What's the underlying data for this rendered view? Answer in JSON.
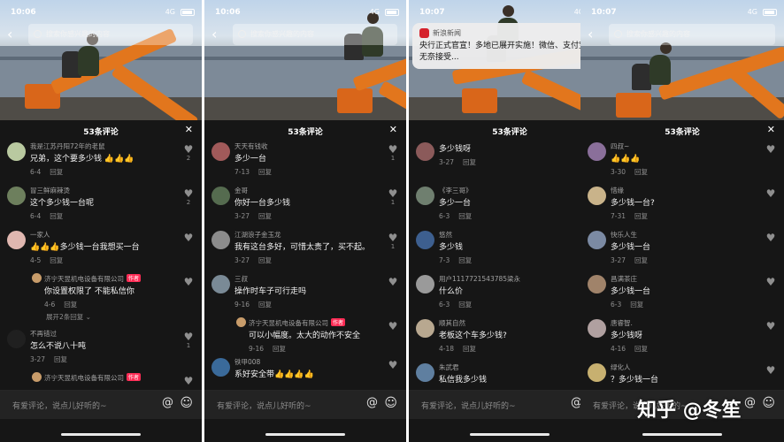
{
  "colors": {
    "background": "#161616",
    "username": "#a2a2a2",
    "text": "#f2f2f2",
    "meta": "#8f8f8f",
    "author_tag": "#fe2c55",
    "excavator": "#e2761d"
  },
  "panels": [
    {
      "time": "10:06",
      "signal": "4G",
      "search_placeholder": "搜索你感兴趣的内容",
      "sheet_title": "53条评论",
      "comments": [
        {
          "user": "我是江苏丹阳72年的老鼠",
          "text": "兄弟，这个要多少钱 👍👍👍",
          "date": "6-4",
          "reply": "回复",
          "likes": "2",
          "avatar_color": "#b9c9a0"
        },
        {
          "user": "冒三鲜麻辣烫",
          "text": "这个多少钱一台呢",
          "date": "6-4",
          "reply": "回复",
          "likes": "2",
          "avatar_color": "#6d7f5d"
        },
        {
          "user": "一家人",
          "text": "👍👍👍多少钱一台我想买一台",
          "date": "4-5",
          "reply": "回复",
          "likes": "",
          "avatar_color": "#e0b7b0"
        },
        {
          "is_reply": true,
          "user": "济宁天昱机电设备有限公司",
          "author_tag": "作者",
          "text": "你设置权限了 不能私信你",
          "date": "4-6",
          "reply": "回复",
          "likes": "",
          "avatar_color": "#c89c6a"
        },
        {
          "expand": "展开2条回复"
        },
        {
          "user": "不再错过",
          "text": "怎么不说八十吨",
          "date": "3-27",
          "reply": "回复",
          "likes": "1",
          "avatar_color": "#202020"
        },
        {
          "is_reply": true,
          "user": "济宁天昱机电设备有限公司",
          "author_tag": "作者",
          "text": "",
          "date": "",
          "reply": "",
          "likes": "",
          "avatar_color": "#c89c6a"
        }
      ],
      "input_placeholder": "有爱评论，说点儿好听的~"
    },
    {
      "time": "10:06",
      "signal": "4G",
      "search_placeholder": "搜索你感兴趣的内容",
      "sheet_title": "53条评论",
      "comments": [
        {
          "user": "天天有钱收",
          "text": "多少一台",
          "date": "7-13",
          "reply": "回复",
          "likes": "1",
          "avatar_color": "#a15a5a"
        },
        {
          "user": "金哥",
          "text": "你好一台多少钱",
          "date": "3-27",
          "reply": "回复",
          "likes": "1",
          "avatar_color": "#556b4f"
        },
        {
          "user": "江湖浪子金玉龙",
          "text": "我有这台多好，可惜太贵了，买不起。",
          "date": "3-27",
          "reply": "回复",
          "likes": "1",
          "avatar_color": "#8c8c8c"
        },
        {
          "user": "三叔",
          "text": "操作时车子可行走吗",
          "date": "9-16",
          "reply": "回复",
          "likes": "",
          "avatar_color": "#7a8a96"
        },
        {
          "is_reply": true,
          "user": "济宁天昱机电设备有限公司",
          "author_tag": "作者",
          "text": "可以小幅度。太大的动作不安全",
          "date": "9-16",
          "reply": "回复",
          "likes": "",
          "avatar_color": "#c89c6a"
        },
        {
          "user": "铁甲008",
          "text": "系好安全带👍👍👍👍",
          "date": "",
          "reply": "",
          "likes": "",
          "avatar_color": "#3a6a9a"
        }
      ],
      "input_placeholder": "有爱评论，说点儿好听的~"
    },
    {
      "time": "10:07",
      "signal": "4G",
      "notification": {
        "source": "新浪新闻",
        "body": "央行正式官宣！多地已展开实施！微信、支付宝只能无奈接受..."
      },
      "sheet_title": "53条评论",
      "comments": [
        {
          "user": "",
          "text": "多少钱呀",
          "date": "3-27",
          "reply": "回复",
          "likes": "",
          "avatar_color": "#8b5a5a"
        },
        {
          "user": "《李三哥》",
          "text": "多少一台",
          "date": "6-3",
          "reply": "回复",
          "likes": "",
          "avatar_color": "#6f7f6f"
        },
        {
          "user": "悠然",
          "text": "多少钱",
          "date": "7-3",
          "reply": "回复",
          "likes": "",
          "avatar_color": "#3d5f8f"
        },
        {
          "user": "用户1117721543785梁永",
          "text": "什么价",
          "date": "6-3",
          "reply": "回复",
          "likes": "",
          "avatar_color": "#9a9a9a"
        },
        {
          "user": "顺其自然",
          "text": "老板这个车多少钱?",
          "date": "4-18",
          "reply": "回复",
          "likes": "",
          "avatar_color": "#b8a890"
        },
        {
          "user": "朱武君",
          "text": "私信我多少钱",
          "date": "",
          "reply": "",
          "likes": "",
          "avatar_color": "#5f7fa0"
        }
      ],
      "input_placeholder": "有爱评论，说点儿好听的~"
    },
    {
      "time": "10:07",
      "signal": "4G",
      "search_placeholder": "搜索你感兴趣的内容",
      "sheet_title": "53条评论",
      "comments": [
        {
          "user": "四叔~",
          "text": "👍👍👍",
          "date": "3-30",
          "reply": "回复",
          "likes": "",
          "avatar_color": "#8a6f9a"
        },
        {
          "user": "惜缘",
          "text": "多少钱一台?",
          "date": "7-31",
          "reply": "回复",
          "likes": "",
          "avatar_color": "#c9b38a"
        },
        {
          "user": "快乐人生",
          "text": "多少钱一台",
          "date": "3-27",
          "reply": "回复",
          "likes": "",
          "avatar_color": "#7b8aa3"
        },
        {
          "user": "昌满茶庄",
          "text": "多少钱一台",
          "date": "6-3",
          "reply": "回复",
          "likes": "",
          "avatar_color": "#a0836a"
        },
        {
          "user": "唐睿智.",
          "text": "多少钱呀",
          "date": "4-16",
          "reply": "回复",
          "likes": "",
          "avatar_color": "#b0a0a0"
        },
        {
          "user": "绿化人",
          "text": "？多少钱一台",
          "date": "",
          "reply": "",
          "likes": "",
          "avatar_color": "#c7b070"
        }
      ],
      "input_placeholder": "有爱评论，说点儿好听的~"
    }
  ],
  "icons": {
    "back": "chevron-left-icon",
    "search": "search-icon",
    "close": "close-icon",
    "heart": "heart-icon",
    "at": "at-icon",
    "emoji": "emoji-icon"
  },
  "watermark": "知乎 @冬笙"
}
